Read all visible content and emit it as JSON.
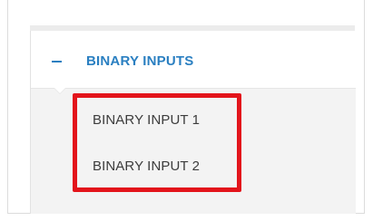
{
  "section": {
    "title": "BINARY INPUTS",
    "collapse_icon": "minus-icon",
    "expanded": true,
    "accent_color": "#2a7fc1"
  },
  "submenu": {
    "items": [
      {
        "label": "BINARY INPUT 1"
      },
      {
        "label": "BINARY INPUT 2"
      }
    ]
  },
  "annotation": {
    "highlight_color": "#e3141b"
  }
}
